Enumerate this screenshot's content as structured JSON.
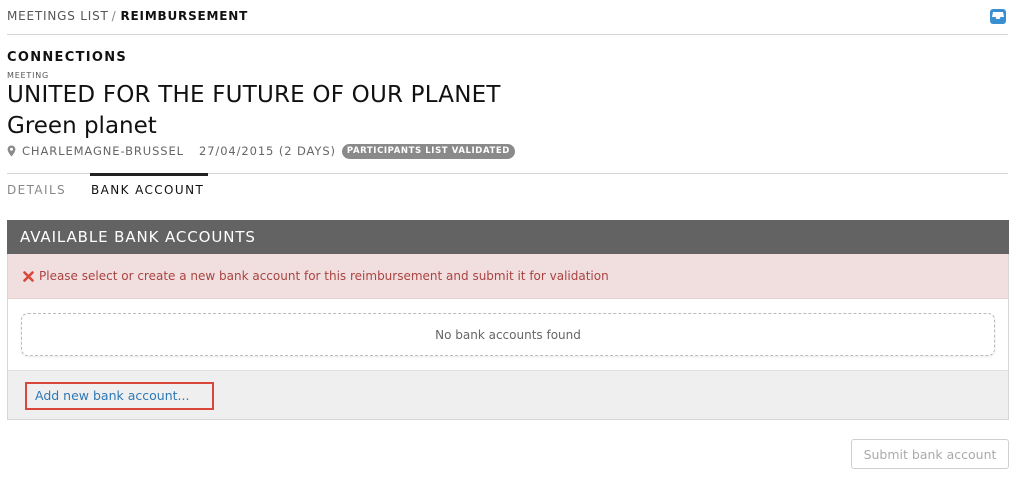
{
  "breadcrumb": {
    "items": [
      {
        "label": "MEETINGS LIST"
      },
      {
        "label": "REIMBURSEMENT"
      }
    ],
    "separator": "/"
  },
  "header": {
    "icon": "inbox-icon",
    "section_title": "CONNECTIONS",
    "meeting_label": "MEETING",
    "meeting_title": "UNITED FOR THE FUTURE OF OUR PLANET",
    "meeting_subtitle": "Green planet",
    "location_icon": "map-pin-icon",
    "location": "CHARLEMAGNE-BRUSSEL",
    "date": "27/04/2015 (2 DAYS)",
    "status_badge": "PARTICIPANTS LIST VALIDATED"
  },
  "tabs": [
    {
      "label": "DETAILS",
      "active": false
    },
    {
      "label": "BANK ACCOUNT",
      "active": true
    }
  ],
  "bank_panel": {
    "title": "AVAILABLE BANK ACCOUNTS",
    "alert_icon": "close-x-icon",
    "alert_text": "Please select or create a new bank account for this reimbursement and submit it for validation",
    "empty_message": "No bank accounts found",
    "add_link": "Add new bank account..."
  },
  "actions": {
    "submit_label": "Submit bank account"
  },
  "colors": {
    "panel_header": "#636363",
    "alert_background": "#f1dede",
    "alert_text": "#a94442",
    "link": "#2f78b5",
    "highlight_border": "#d9463b",
    "badge": "#8a8a8a",
    "inbox_icon": "#3a8fd1"
  }
}
